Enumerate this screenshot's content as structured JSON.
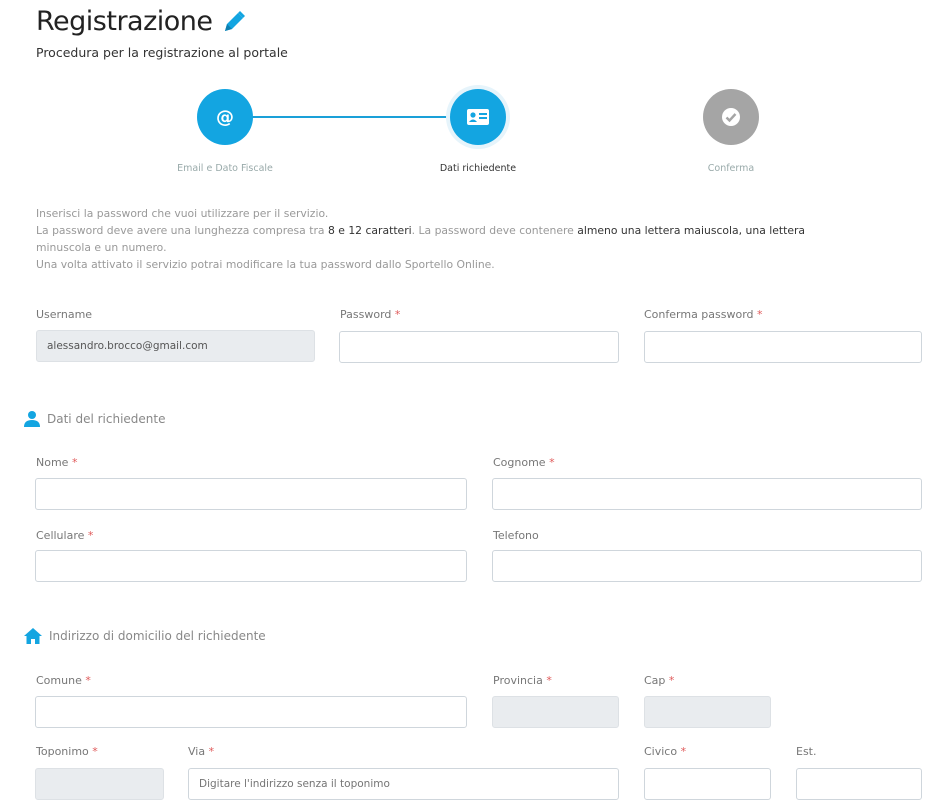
{
  "header": {
    "title": "Registrazione",
    "subtitle": "Procedura per la registrazione al portale"
  },
  "steps": [
    {
      "label": "Email e Dato Fiscale",
      "icon": "at-icon",
      "state": "done"
    },
    {
      "label": "Dati richiedente",
      "icon": "id-card-icon",
      "state": "current"
    },
    {
      "label": "Conferma",
      "icon": "check-icon",
      "state": "pending"
    }
  ],
  "info": {
    "line1": "Inserisci la password che vuoi utilizzare per il servizio.",
    "line2_a": "La password deve avere una lunghezza compresa tra ",
    "line2_b": "8 e 12 caratteri",
    "line2_c": ". La password deve contenere ",
    "line2_d": "almeno una lettera maiuscola, una lettera",
    "line3": "minuscola e un numero.",
    "line4": "Una volta attivato il servizio potrai modificare la tua password dallo Sportello Online."
  },
  "credentials": {
    "username_label": "Username",
    "username_value": "alessandro.brocco@gmail.com",
    "password_label": "Password",
    "confirm_label": "Conferma password",
    "required_mark": "*"
  },
  "applicant": {
    "section_title": "Dati del richiedente",
    "nome_label": "Nome",
    "cognome_label": "Cognome",
    "cellulare_label": "Cellulare",
    "telefono_label": "Telefono"
  },
  "address": {
    "section_title": "Indirizzo di domicilio del richiedente",
    "comune_label": "Comune",
    "provincia_label": "Provincia",
    "cap_label": "Cap",
    "toponimo_label": "Toponimo",
    "via_label": "Via",
    "via_placeholder": "Digitare l'indirizzo senza il toponimo",
    "civico_label": "Civico",
    "est_label": "Est."
  },
  "colors": {
    "accent": "#13a5e1",
    "inactive": "#a5a5a5",
    "required": "#e05a5a"
  }
}
